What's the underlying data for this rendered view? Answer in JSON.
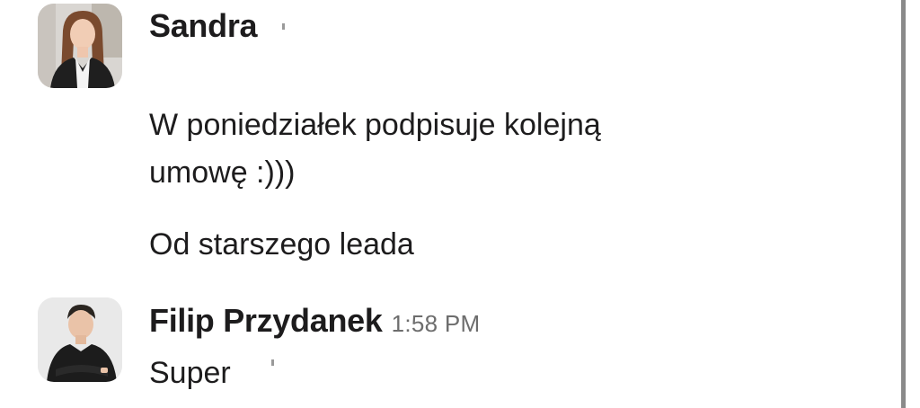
{
  "messages": [
    {
      "sender": "Sandra",
      "time": "",
      "avatar_icon": "user-avatar-woman",
      "lines": [
        "W poniedziałek podpisuje kolejną",
        "umowę :)))",
        "Od starszego leada"
      ]
    },
    {
      "sender": "Filip Przydanek",
      "time": "1:58 PM",
      "avatar_icon": "user-avatar-man",
      "lines": [
        "Super"
      ]
    }
  ],
  "colors": {
    "text": "#1d1c1d",
    "timestamp": "#6d6d6d",
    "background": "#ffffff"
  }
}
